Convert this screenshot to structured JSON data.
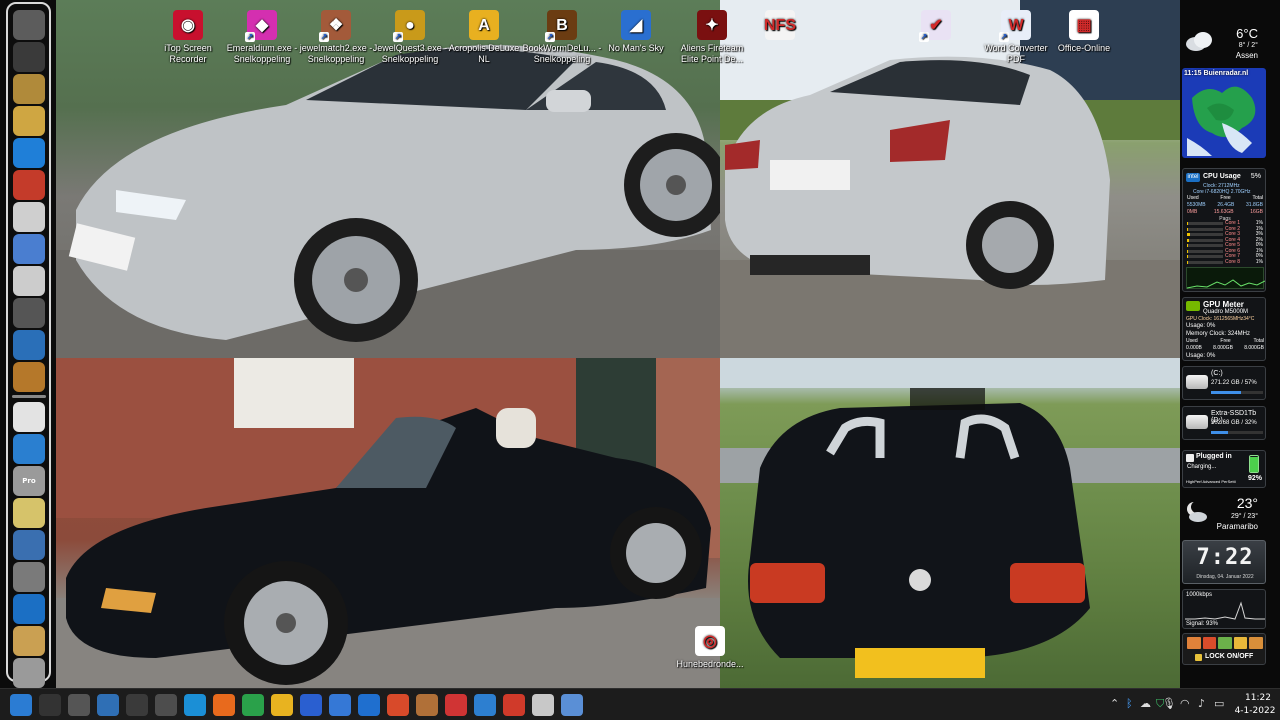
{
  "desktop_icons": [
    {
      "label": "iTop Screen Recorder",
      "icon": "itop-recorder-icon",
      "color": "#c8102e",
      "glyph": "◉",
      "shortcut": false
    },
    {
      "label": "Emeraldium.exe - Snelkoppeling",
      "icon": "emeraldium-gem-icon",
      "color": "#d42fb0",
      "glyph": "◆",
      "shortcut": true
    },
    {
      "label": "jewelmatch2.exe - Snelkoppeling",
      "icon": "jewelmatch-icon",
      "color": "#a35a3a",
      "glyph": "❖",
      "shortcut": true
    },
    {
      "label": "JewelQuest3.exe - Snelkoppeling",
      "icon": "jewelquest-icon",
      "color": "#c99a1a",
      "glyph": "●",
      "shortcut": true
    },
    {
      "label": "Acropolis DeLuxe NL",
      "icon": "acropolis-icon",
      "color": "#e8b020",
      "glyph": "A",
      "shortcut": false
    },
    {
      "label": "BookWormDeLu... - Snelkoppeling",
      "icon": "bookworm-icon",
      "color": "#6b3c12",
      "glyph": "B",
      "shortcut": true
    },
    {
      "label": "No Man's Sky",
      "icon": "no-mans-sky-icon",
      "color": "#2a6fd0",
      "glyph": "◢",
      "shortcut": false
    },
    {
      "label": "Aliens Fireteam Elite Point De...",
      "icon": "aliens-fireteam-icon",
      "color": "#7a1010",
      "glyph": "✦",
      "shortcut": false
    },
    {
      "label": "",
      "icon": "nfs-game-icon",
      "color": "#f4f4f4",
      "glyph": "NFS",
      "shortcut": false
    },
    {
      "label": "",
      "icon": "task-checklist-icon",
      "color": "#e9e2f4",
      "glyph": "✔",
      "shortcut": true
    },
    {
      "label": "Word Converter PDF",
      "icon": "word-pdf-converter-icon",
      "color": "#e8eef8",
      "glyph": "W",
      "shortcut": true
    },
    {
      "label": "Office-Online",
      "icon": "office-online-icon",
      "color": "#ffffff",
      "glyph": "▦",
      "shortcut": false
    },
    {
      "label": "Hunebedronde...",
      "icon": "chrome-icon",
      "color": "#ffffff",
      "glyph": "◎",
      "shortcut": false
    }
  ],
  "dock": {
    "items": [
      "antenna-icon",
      "hard-drive-icon",
      "webcam-icon",
      "notes-icon",
      "teamviewer-icon",
      "downloader-icon",
      "tools-icon",
      "computer-icon",
      "hammer-icon",
      "media-player-icon",
      "ccleaner-icon",
      "emblem-icon",
      "scanner-icon",
      "flash-icon",
      "pro-app-icon",
      "bone-icon",
      "robot-icon",
      "server-icon",
      "hp-icon",
      "stag-icon",
      "recycle-bin-icon"
    ],
    "pro_label": "Pro"
  },
  "weather_top": {
    "temp": "6°C",
    "range": "8° / 2°",
    "city": "Assen"
  },
  "radar": {
    "time_label": "11:15 Buienradar.nl"
  },
  "cpu": {
    "title": "CPU Usage",
    "percent": "5%",
    "brand": "intel",
    "clock": "Clock: 2712MHz",
    "model": "Core i7-6820HQ 2.70GHz",
    "headers": [
      "Used",
      "Free",
      "Total"
    ],
    "row1": [
      "5530MB",
      "26.4GB",
      "31.8GB"
    ],
    "row2": [
      "0MB",
      "15.63GB",
      "16GB"
    ],
    "page_label": "Pags",
    "cores": [
      [
        "Core 1",
        "1%"
      ],
      [
        "Core 2",
        "1%"
      ],
      [
        "Core 3",
        "3%"
      ],
      [
        "Core 4",
        "2%"
      ],
      [
        "Core 5",
        "0%"
      ],
      [
        "Core 6",
        "1%"
      ],
      [
        "Core 7",
        "0%"
      ],
      [
        "Core 8",
        "1%"
      ]
    ]
  },
  "gpu": {
    "title": "GPU Meter",
    "model": "Quadro M5000M",
    "clock": "GPU Clock: 1612565MHz34°C",
    "usage1": "Usage: 0%",
    "memclock": "Memory Clock: 324MHz",
    "headers": [
      "Used",
      "Free",
      "Total"
    ],
    "row": [
      "0.000B",
      "8.000GB",
      "8.000GB"
    ],
    "usage2": "Usage: 0%"
  },
  "drives": [
    {
      "name": "(C:)",
      "stats": "271.22 GB / 57%",
      "fill": 0.57
    },
    {
      "name": "Extra-SSD1Tb (D:)",
      "stats": "302.68 GB / 32%",
      "fill": 0.32
    }
  ],
  "battery": {
    "status": "Plugged in",
    "charging": "Charging...",
    "percent": "92%",
    "plan": "HighPerf Advanced PerSetti",
    "level": 0.92
  },
  "weather_bottom": {
    "temp": "23°",
    "range": "29° / 23°",
    "city": "Paramaribo"
  },
  "clock_gadget": {
    "time": "7:22",
    "date": "Dinsdag, 04. Januar 2022"
  },
  "network": {
    "speed": "1000kbps",
    "signal": "Signal: 93%"
  },
  "lock": {
    "label": "LOCK ON/OFF"
  },
  "taskbar": {
    "apps": [
      "windows-start-icon",
      "search-icon",
      "task-view-icon",
      "widgets-icon",
      "monitor-app-icon",
      "calculator-app-icon",
      "edge-icon",
      "firefox-icon",
      "chrome-icon",
      "file-explorer-icon",
      "save-disk-icon",
      "store-icon",
      "mail-icon",
      "office-icon",
      "game-character-icon",
      "puzzle-icon",
      "network-app-icon",
      "recorder-icon",
      "photo-viewer-icon",
      "browser-orb-icon"
    ],
    "time": "11:22",
    "date": "4-1-2022"
  }
}
